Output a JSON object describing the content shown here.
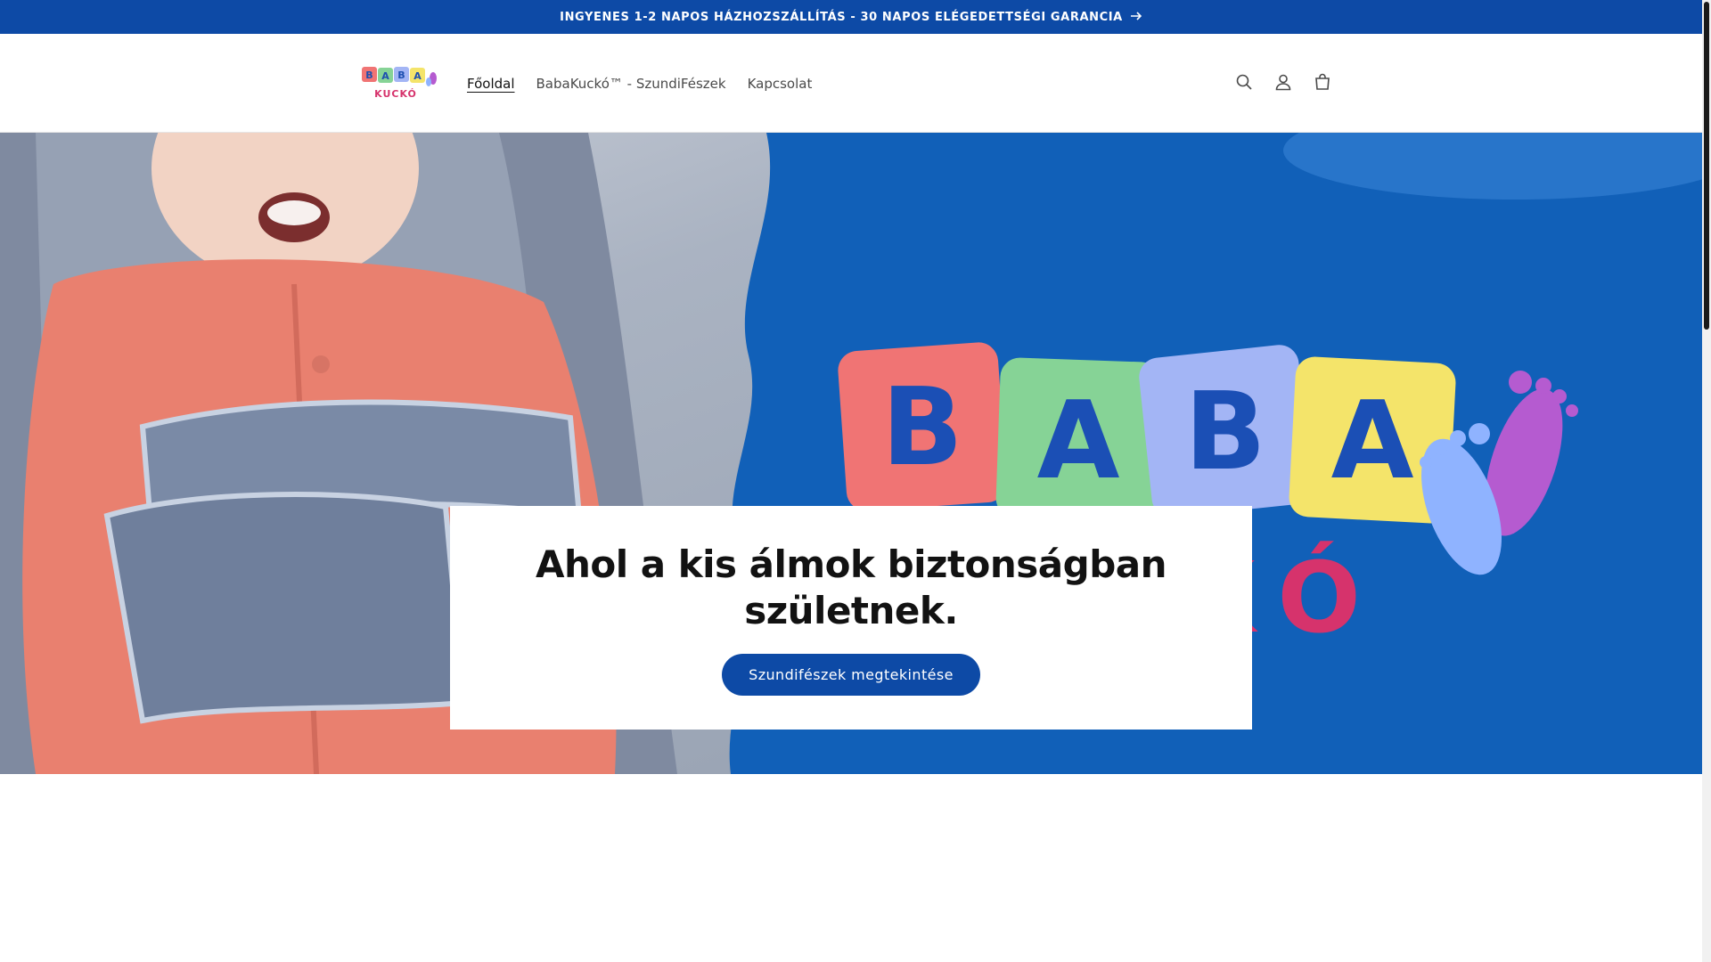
{
  "announcement": {
    "text": "INGYENES 1-2 NAPOS HÁZHOZSZÁLLÍTÁS - 30 NAPOS ELÉGEDETTSÉGI GARANCIA",
    "arrow_icon": "arrow-right-icon"
  },
  "header": {
    "logo": {
      "top_letters": [
        "B",
        "A",
        "B",
        "A"
      ],
      "bottom_text": "KUCKÓ"
    },
    "nav": [
      {
        "label": "Főoldal",
        "active": true
      },
      {
        "label": "BabaKuckó™ - SzundiFészek",
        "active": false
      },
      {
        "label": "Kapcsolat",
        "active": false
      }
    ],
    "icons": [
      "search-icon",
      "account-icon",
      "cart-icon"
    ]
  },
  "hero": {
    "title": "Ahol a kis álmok biztonságban születnek.",
    "button_label": "Szundifészek megtekintése",
    "image_blocks": [
      "B",
      "A",
      "B",
      "A"
    ],
    "image_subtext": "KÓ"
  },
  "colors": {
    "brand_blue": "#0d4aa6",
    "hero_blue": "#1160b8",
    "block_red": "#f07474",
    "block_green": "#86d396",
    "block_lilac": "#a3b5f5",
    "block_yellow": "#f4e46a",
    "foot_purple": "#b55bd0",
    "foot_blue": "#8fb3ff",
    "text_pink": "#d6336c"
  }
}
